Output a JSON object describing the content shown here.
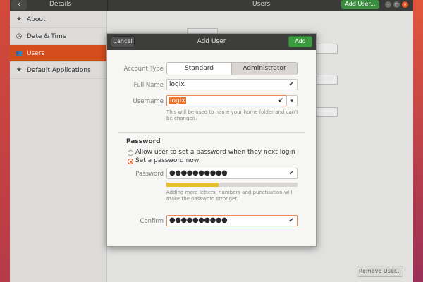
{
  "headerbar": {
    "back_glyph": "‹",
    "left_title": "Details",
    "title": "Users",
    "add_user_label": "Add User...",
    "min_glyph": "–",
    "max_glyph": "□",
    "close_glyph": "×"
  },
  "sidebar": {
    "items": [
      {
        "icon": "✦",
        "icon_name": "star-icon",
        "label": "About"
      },
      {
        "icon": "◷",
        "icon_name": "clock-icon",
        "label": "Date & Time"
      },
      {
        "icon": "👥",
        "icon_name": "users-icon",
        "label": "Users",
        "active": true
      },
      {
        "icon": "★",
        "icon_name": "star-icon",
        "label": "Default Applications"
      }
    ]
  },
  "content": {
    "remove_user_label": "Remove User..."
  },
  "dialog": {
    "title": "Add User",
    "cancel_label": "Cancel",
    "add_label": "Add",
    "account_type_label": "Account Type",
    "account_types": [
      "Standard",
      "Administrator"
    ],
    "account_type_selected": "Standard",
    "full_name_label": "Full Name",
    "full_name_value": "logix",
    "username_label": "Username",
    "username_value": "logix",
    "username_hint": "This will be used to name your home folder and can't be changed.",
    "password_section_title": "Password",
    "password_options": [
      {
        "label": "Allow user to set a password when they next login",
        "selected": false
      },
      {
        "label": "Set a password now",
        "selected": true
      }
    ],
    "password_label": "Password",
    "password_value": "●●●●●●●●●●",
    "password_strength": 0.4,
    "password_hint": "Adding more letters, numbers and punctuation will make the password stronger.",
    "confirm_label": "Confirm",
    "confirm_value": "●●●●●●●●●●",
    "check_glyph": "✔",
    "dropdown_glyph": "▾"
  },
  "colors": {
    "accent": "#e95420",
    "add_button": "#3b9c3f",
    "strength_fill": "#e6c02a",
    "headerbar": "#3a3a38"
  }
}
